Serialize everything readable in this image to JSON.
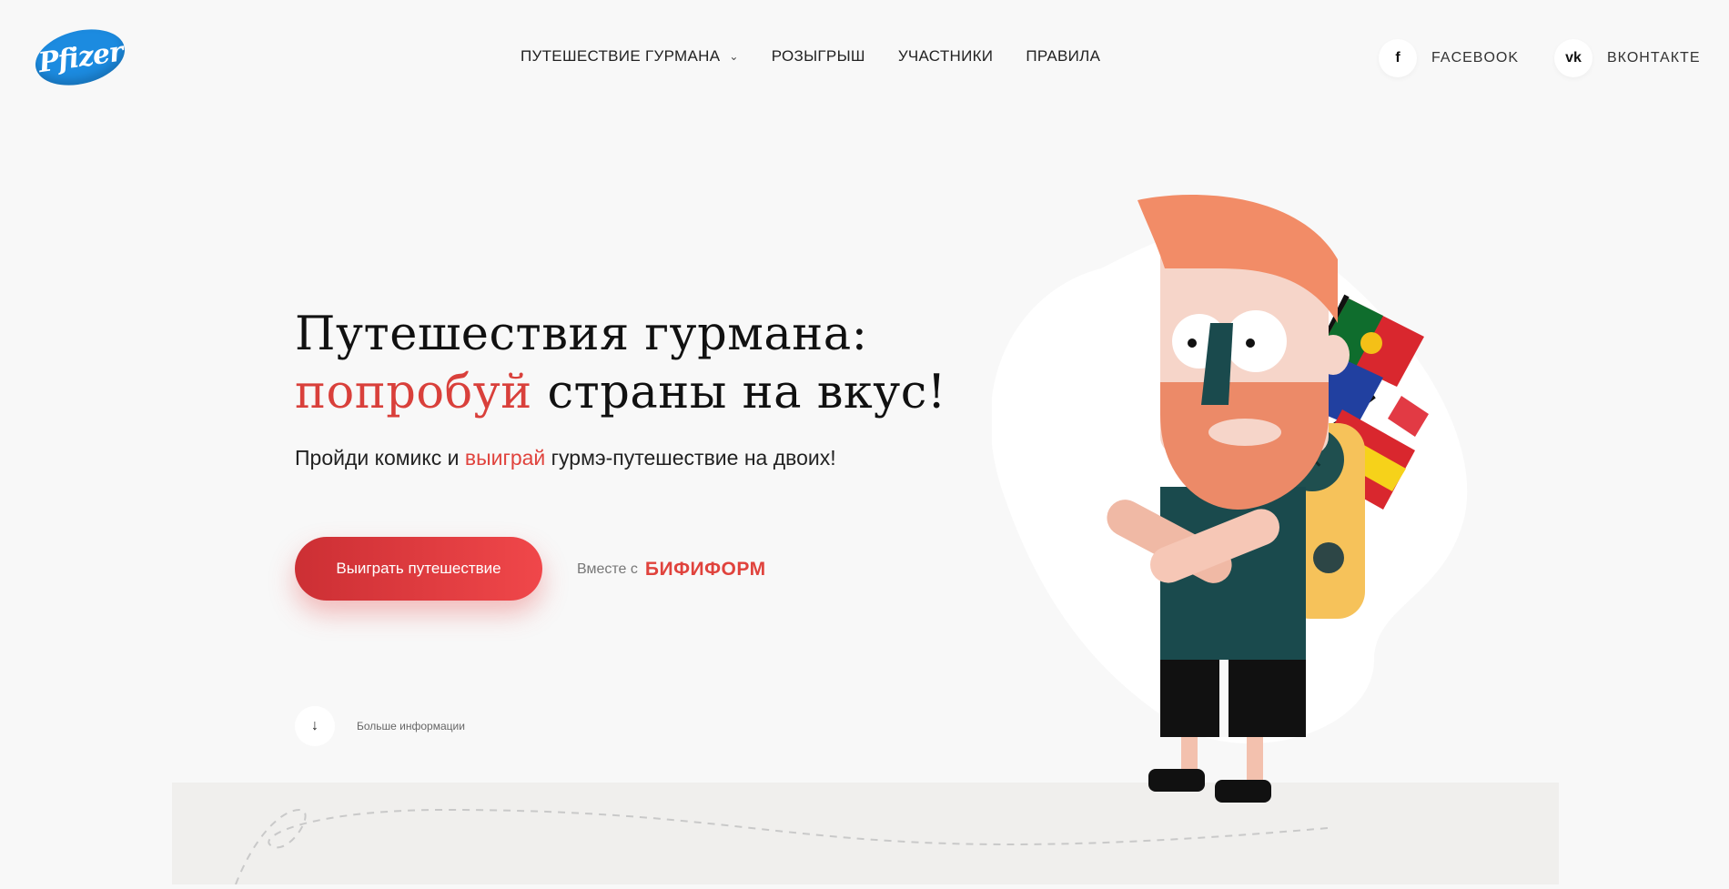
{
  "brand": {
    "logo_text": "Pfizer"
  },
  "nav": {
    "items": [
      {
        "label": "ПУТЕШЕСТВИЕ ГУРМАНА",
        "has_dropdown": true
      },
      {
        "label": "РОЗЫГРЫШ"
      },
      {
        "label": "УЧАСТНИКИ"
      },
      {
        "label": "ПРАВИЛА"
      }
    ]
  },
  "social": {
    "facebook": {
      "icon": "f",
      "label": "FACEBOOK"
    },
    "vk": {
      "icon": "vk",
      "label": "ВКОНТАКТЕ"
    }
  },
  "hero": {
    "title_line1": "Путешествия гурмана:",
    "title_accent": "попробуй",
    "title_rest": "страны на вкус!",
    "subtitle_pre": "Пройди комикс и ",
    "subtitle_accent": "выиграй",
    "subtitle_post": " гурмэ-путешествие на двоих!",
    "cta_label": "Выиграть путешествие",
    "together_label": "Вместе с",
    "partner_brand": "БИФИФОРМ",
    "more_label": "Больше информации"
  },
  "colors": {
    "accent": "#e0433d",
    "logo_blue": "#1c8be0",
    "background": "#f8f8f8"
  },
  "icons": {
    "dropdown": "chevron-down-icon",
    "more": "arrow-down-icon"
  }
}
